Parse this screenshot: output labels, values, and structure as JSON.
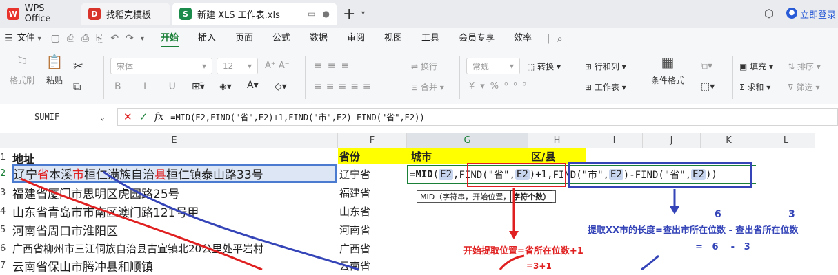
{
  "tabs": {
    "wps": {
      "label": "WPS Office"
    },
    "template": {
      "label": "找稻壳模板"
    },
    "doc": {
      "label": "新建 XLS 工作表.xls"
    },
    "login": "立即登录"
  },
  "menubar": {
    "file": "文件",
    "items": [
      "开始",
      "插入",
      "页面",
      "公式",
      "数据",
      "审阅",
      "视图",
      "工具",
      "会员专享",
      "效率"
    ]
  },
  "ribbon": {
    "format_painter": "格式刷",
    "paste": "粘贴",
    "font_name": "宋体",
    "font_size": "12",
    "wrap": "换行",
    "merge": "合并",
    "number_format": "常规",
    "convert": "转换",
    "row_col": "行和列",
    "sheet": "工作表",
    "cond_format": "条件格式",
    "fill": "填充",
    "sort": "排序",
    "sum": "求和",
    "filter": "筛选"
  },
  "formula_bar": {
    "name_box": "SUMIF",
    "formula": "=MID(E2,FIND(\"省\",E2)+1,FIND(\"市\",E2)-FIND(\"省\",E2))"
  },
  "grid": {
    "columns": [
      "E",
      "F",
      "G",
      "H",
      "I",
      "J",
      "K",
      "L"
    ],
    "rows": [
      "1",
      "2",
      "3",
      "4",
      "5",
      "6",
      "7"
    ],
    "headers": {
      "e": "地址",
      "f": "省份",
      "g": "城市",
      "h": "区/县"
    },
    "addresses": [
      [
        "辽宁",
        "省",
        "本溪",
        "市",
        "桓仁满族自治",
        "县",
        "桓仁镇泰山路33号"
      ],
      "福建省厦门市思明区虎园路25号",
      "山东省青岛市市南区澳门路121号甲",
      "河南省周口市淮阳区",
      "广西省柳州市三江侗族自治县古宜镇北20公里处平岩村",
      "云南省保山市腾冲县和顺镇"
    ],
    "provinces": [
      "辽宁省",
      "福建省",
      "山东省",
      "河南省",
      "广西省",
      "云南省"
    ],
    "edit_formula": {
      "prefix": "=",
      "fn": "MID",
      "p1": "(",
      "e2a": "E2",
      "c1": ",",
      "find1": "FIND(\"省\",",
      "e2b": "E2",
      "find1end": ")",
      "plus": "+1",
      "c2": ",",
      "find2": "FIND(\"市\",",
      "e2c": "E2",
      "mid": ")-FIND(\"省\",",
      "e2d": "E2",
      "end": "))"
    },
    "tooltip": {
      "fn": "MID（字符串，开始位置，",
      "arg": "字符个数）"
    }
  },
  "annotations": {
    "start_pos": "开始提取位置=省所在位数+1",
    "length": "提取XX市的长度=查出市所在位数 - 查出省所在位数",
    "n6": "6",
    "n3": "3",
    "calc": "=   6    -   3",
    "partial": "=3+1"
  },
  "colors": {
    "accent": "#1a7f37",
    "red": "#e02020",
    "blue": "#3545b8",
    "yellow": "#ffff00"
  }
}
